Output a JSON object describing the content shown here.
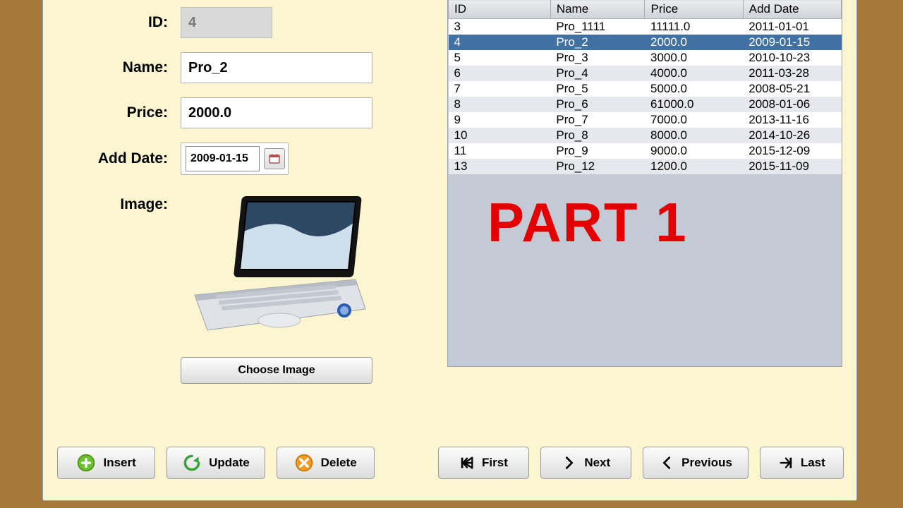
{
  "form": {
    "labels": {
      "id": "ID:",
      "name": "Name:",
      "price": "Price:",
      "add_date": "Add Date:",
      "image": "Image:"
    },
    "values": {
      "id": "4",
      "name": "Pro_2",
      "price": "2000.0",
      "add_date": "2009-01-15"
    },
    "choose_image_label": "Choose Image"
  },
  "table": {
    "columns": [
      "ID",
      "Name",
      "Price",
      "Add Date"
    ],
    "selected_id": "4",
    "rows": [
      {
        "id": "3",
        "name": "Pro_1111",
        "price": "11111.0",
        "add_date": "2011-01-01"
      },
      {
        "id": "4",
        "name": "Pro_2",
        "price": "2000.0",
        "add_date": "2009-01-15"
      },
      {
        "id": "5",
        "name": "Pro_3",
        "price": "3000.0",
        "add_date": "2010-10-23"
      },
      {
        "id": "6",
        "name": "Pro_4",
        "price": "4000.0",
        "add_date": "2011-03-28"
      },
      {
        "id": "7",
        "name": "Pro_5",
        "price": "5000.0",
        "add_date": "2008-05-21"
      },
      {
        "id": "8",
        "name": "Pro_6",
        "price": "61000.0",
        "add_date": "2008-01-06"
      },
      {
        "id": "9",
        "name": "Pro_7",
        "price": "7000.0",
        "add_date": "2013-11-16"
      },
      {
        "id": "10",
        "name": "Pro_8",
        "price": "8000.0",
        "add_date": "2014-10-26"
      },
      {
        "id": "11",
        "name": "Pro_9",
        "price": "9000.0",
        "add_date": "2015-12-09"
      },
      {
        "id": "13",
        "name": "Pro_12",
        "price": "1200.0",
        "add_date": "2015-11-09"
      }
    ]
  },
  "toolbar": {
    "insert": "Insert",
    "update": "Update",
    "delete": "Delete",
    "first": "First",
    "next": "Next",
    "previous": "Previous",
    "last": "Last"
  },
  "overlay": "PART 1"
}
